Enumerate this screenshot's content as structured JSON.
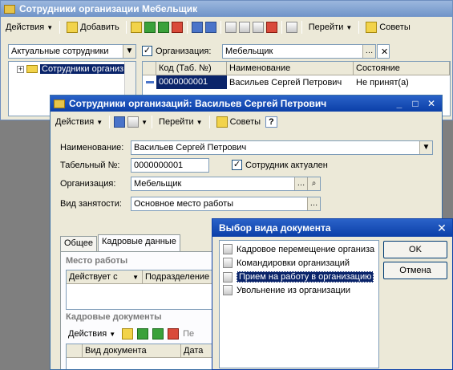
{
  "main_window": {
    "title": "Сотрудники организации Мебельщик",
    "toolbar": {
      "actions": "Действия",
      "add": "Добавить",
      "goto": "Перейти",
      "tips": "Советы"
    },
    "filter_select": "Актуальные сотрудники",
    "org_label": "Организация:",
    "org_value": "Мебельщик",
    "tree_item": "Сотрудники организ",
    "grid": {
      "columns": [
        "Код (Таб. №)",
        "Наименование",
        "Состояние"
      ],
      "row": {
        "code": "0000000001",
        "name": "Васильев Сергей Петрович",
        "state": "Не принят(а)"
      }
    }
  },
  "employee_window": {
    "title": "Сотрудники организаций: Васильев Сергей Петрович",
    "toolbar": {
      "actions": "Действия",
      "goto": "Перейти",
      "tips": "Советы",
      "help": "?"
    },
    "name_label": "Наименование:",
    "name_value": "Васильев Сергей Петрович",
    "tab_label": "Табельный №:",
    "tab_value": "0000000001",
    "active_label": "Сотрудник актуален",
    "org_label": "Организация:",
    "org_value": "Мебельщик",
    "employment_label": "Вид занятости:",
    "employment_value": "Основное место работы",
    "tabs": [
      "Общее",
      "Кадровые данные"
    ],
    "workplace_header": "Место работы",
    "workplace_columns": [
      "Действует с",
      "Подразделение"
    ],
    "hr_docs_header": "Кадровые документы",
    "hr_actions": "Действия",
    "hr_columns": [
      "Вид документа",
      "Дата"
    ],
    "hr_truncated": "Пе"
  },
  "doc_dialog": {
    "title": "Выбор вида документа",
    "items": [
      "Кадровое перемещение организа",
      "Командировки организаций",
      "Прием на работу в организацию",
      "Увольнение из организации"
    ],
    "selected_index": 2,
    "ok": "OK",
    "cancel": "Отмена"
  }
}
